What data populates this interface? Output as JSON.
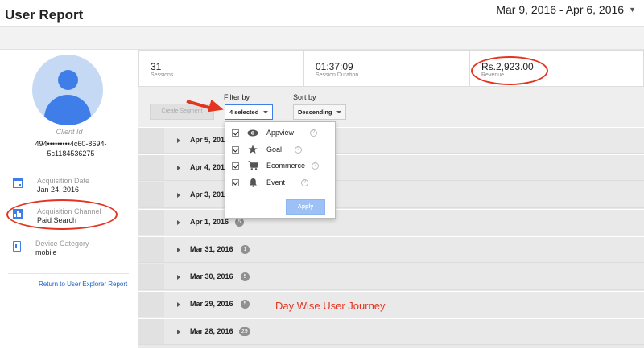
{
  "header": {
    "title": "User Report",
    "date_range": "Mar 9, 2016 - Apr 6, 2016"
  },
  "client": {
    "label": "Client Id",
    "id_line1": "494•••••••••4c60-8694-",
    "id_line2": "5c1184536275"
  },
  "acquisition_date": {
    "label": "Acquisition Date",
    "value": "Jan 24, 2016"
  },
  "acquisition_channel": {
    "label": "Acquisition Channel",
    "value": "Paid Search"
  },
  "device_category": {
    "label": "Device Category",
    "value": "mobile"
  },
  "return_link": "Return to User Explorer Report",
  "stats": [
    {
      "value": "31",
      "label": "Sessions"
    },
    {
      "value": "01:37:09",
      "label": "Session Duration"
    },
    {
      "value": "Rs.2,923.00",
      "label": "Revenue"
    }
  ],
  "controls": {
    "segment_button": "Create Segment",
    "filter_label": "Filter by",
    "filter_value": "4 selected",
    "sort_label": "Sort by",
    "sort_value": "Descending"
  },
  "filter_options": [
    {
      "label": "Appview",
      "icon": "eye-icon",
      "checked": true
    },
    {
      "label": "Goal",
      "icon": "star-icon",
      "checked": true
    },
    {
      "label": "Ecommerce",
      "icon": "cart-icon",
      "checked": true
    },
    {
      "label": "Event",
      "icon": "bell-icon",
      "checked": true
    }
  ],
  "apply_label": "Apply",
  "rows": [
    {
      "date": "Apr 5, 2016",
      "count": ""
    },
    {
      "date": "Apr 4, 2016",
      "count": ""
    },
    {
      "date": "Apr 3, 2016",
      "count": ""
    },
    {
      "date": "Apr 1, 2016",
      "count": "5"
    },
    {
      "date": "Mar 31, 2016",
      "count": "1"
    },
    {
      "date": "Mar 30, 2016",
      "count": "5"
    },
    {
      "date": "Mar 29, 2016",
      "count": "5"
    },
    {
      "date": "Mar 28, 2016",
      "count": "29"
    }
  ],
  "annotation": {
    "journey_text": "Day Wise User Journey",
    "color": "#e33421"
  },
  "colors": {
    "accent": "#3f7ee8",
    "badge": "#8f8f8f"
  }
}
